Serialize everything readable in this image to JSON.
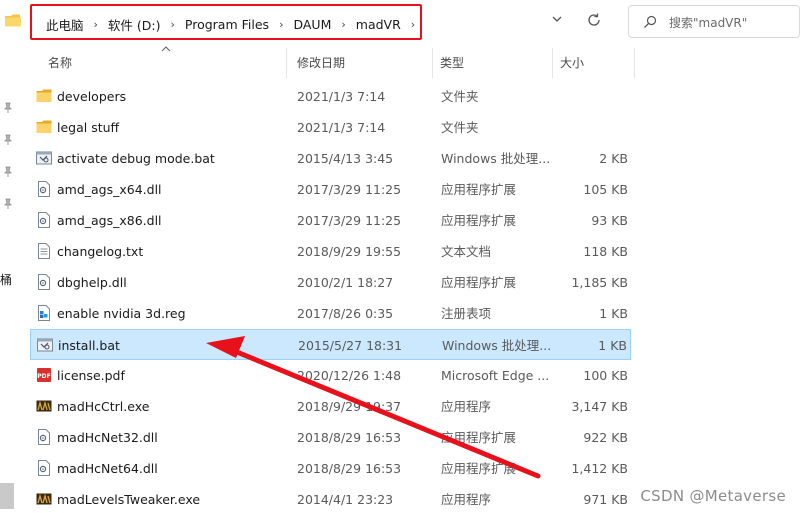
{
  "address": {
    "breadcrumbs": [
      "此电脑",
      "软件 (D:)",
      "Program Files",
      "DAUM",
      "madVR"
    ]
  },
  "search": {
    "placeholder": "搜索\"madVR\""
  },
  "nav": {
    "fragment": "桶"
  },
  "columns": {
    "name": "名称",
    "date": "修改日期",
    "type": "类型",
    "size": "大小"
  },
  "files": [
    {
      "name": "developers",
      "date": "2021/1/3 7:14",
      "type": "文件夹",
      "size": "",
      "icon": "folder-icon"
    },
    {
      "name": "legal stuff",
      "date": "2021/1/3 7:14",
      "type": "文件夹",
      "size": "",
      "icon": "folder-icon"
    },
    {
      "name": "activate debug mode.bat",
      "date": "2015/4/13 3:45",
      "type": "Windows 批处理...",
      "size": "2 KB",
      "icon": "batch-file-icon"
    },
    {
      "name": "amd_ags_x64.dll",
      "date": "2017/3/29 11:25",
      "type": "应用程序扩展",
      "size": "105 KB",
      "icon": "dll-file-icon"
    },
    {
      "name": "amd_ags_x86.dll",
      "date": "2017/3/29 11:25",
      "type": "应用程序扩展",
      "size": "93 KB",
      "icon": "dll-file-icon"
    },
    {
      "name": "changelog.txt",
      "date": "2018/9/29 19:55",
      "type": "文本文档",
      "size": "118 KB",
      "icon": "text-file-icon"
    },
    {
      "name": "dbghelp.dll",
      "date": "2010/2/1 18:27",
      "type": "应用程序扩展",
      "size": "1,185 KB",
      "icon": "dll-file-icon"
    },
    {
      "name": "enable nvidia 3d.reg",
      "date": "2017/8/26 0:35",
      "type": "注册表项",
      "size": "1 KB",
      "icon": "registry-file-icon"
    },
    {
      "name": "install.bat",
      "date": "2015/5/27 18:31",
      "type": "Windows 批处理...",
      "size": "1 KB",
      "icon": "batch-file-icon",
      "selected": true
    },
    {
      "name": "license.pdf",
      "date": "2020/12/26 1:48",
      "type": "Microsoft Edge ...",
      "size": "100 KB",
      "icon": "pdf-file-icon"
    },
    {
      "name": "madHcCtrl.exe",
      "date": "2018/9/29 19:37",
      "type": "应用程序",
      "size": "3,147 KB",
      "icon": "madvr-app-icon"
    },
    {
      "name": "madHcNet32.dll",
      "date": "2018/8/29 16:53",
      "type": "应用程序扩展",
      "size": "922 KB",
      "icon": "dll-file-icon"
    },
    {
      "name": "madHcNet64.dll",
      "date": "2018/8/29 16:53",
      "type": "应用程序扩展",
      "size": "1,412 KB",
      "icon": "dll-file-icon"
    },
    {
      "name": "madLevelsTweaker.exe",
      "date": "2014/4/1 23:23",
      "type": "应用程序",
      "size": "971 KB",
      "icon": "madvr-app-icon"
    }
  ],
  "watermark": "CSDN @Metaverse",
  "colors": {
    "highlight_box": "#e8101a",
    "selected_row": "#cce8ff",
    "annotation_arrow": "#e8101a",
    "folder": "#f5c449"
  }
}
